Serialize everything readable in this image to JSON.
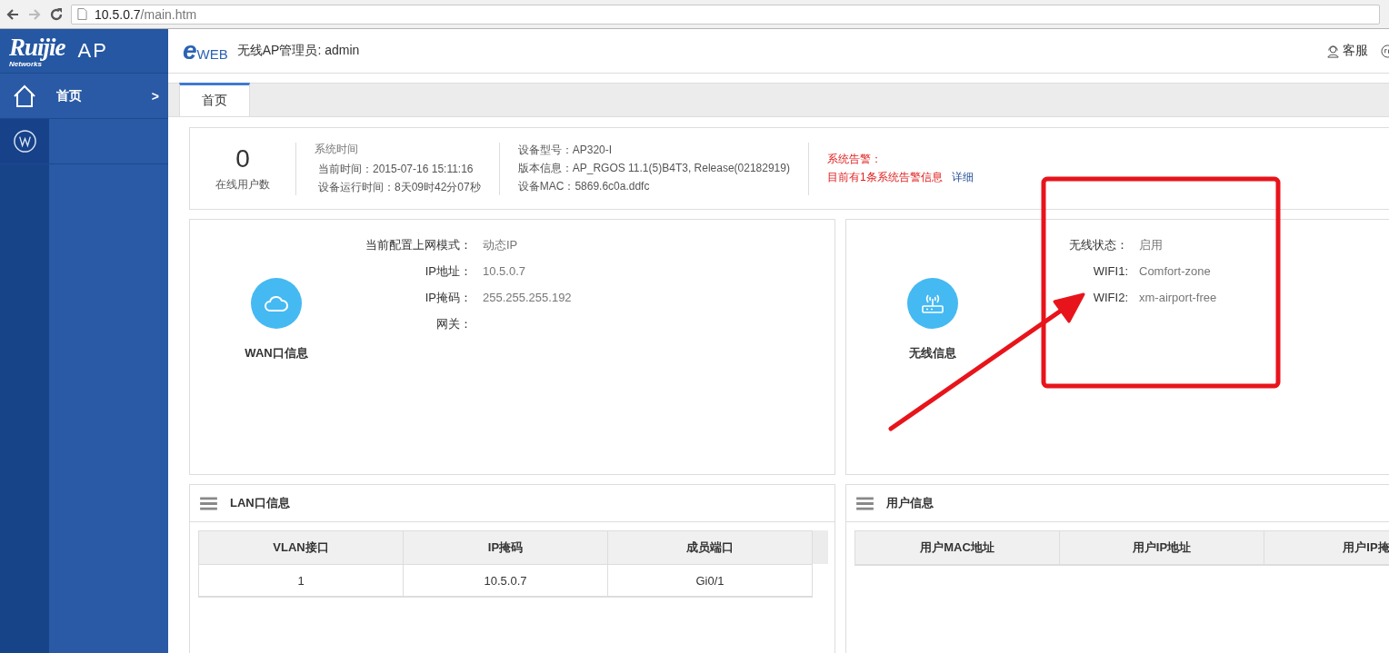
{
  "browser": {
    "url_host": "10.5.0.7",
    "url_path": "/main.htm"
  },
  "logo": {
    "brand": "Ruijie",
    "tagline": "Networks",
    "product": "AP"
  },
  "sidebar": {
    "items": [
      {
        "kind": "home",
        "label": "首页",
        "arrow": ">",
        "selected": true
      },
      {
        "kind": "wireless",
        "selected": false
      }
    ]
  },
  "header": {
    "logo_mark": "e",
    "logo_text": "WEB",
    "title": "无线AP管理员: admin",
    "links": [
      {
        "kind": "support",
        "label": "客服"
      },
      {
        "kind": "help"
      }
    ]
  },
  "tabs": [
    {
      "label": "首页",
      "selected": true
    }
  ],
  "summary": {
    "online_count": "0",
    "online_label": "在线用户数",
    "time_title": "系统时间",
    "time_rows": [
      {
        "label": "当前时间：",
        "value": "2015-07-16 15:11:16"
      },
      {
        "label": "设备运行时间：",
        "value": "8天09时42分07秒"
      }
    ],
    "device_rows": [
      {
        "label": "设备型号：",
        "value": "AP320-I"
      },
      {
        "label": "版本信息：",
        "value": "AP_RGOS 11.1(5)B4T3, Release(02182919)"
      },
      {
        "label": "设备MAC：",
        "value": "5869.6c0a.ddfc"
      }
    ],
    "alarm": {
      "title": "系统告警：",
      "message": "目前有1条系统告警信息",
      "link": "详细"
    }
  },
  "panels": [
    {
      "kind": "wan",
      "title": "WAN口信息",
      "rows": [
        {
          "label": "当前配置上网模式：",
          "value": "动态IP"
        },
        {
          "label": "IP地址：",
          "value": "10.5.0.7"
        },
        {
          "label": "IP掩码：",
          "value": "255.255.255.192"
        },
        {
          "label": "网关："
        }
      ]
    },
    {
      "kind": "wireless",
      "title": "无线信息",
      "rows": [
        {
          "label": "无线状态：",
          "value": "启用"
        },
        {
          "label": "WIFI1:",
          "value": "Comfort-zone"
        },
        {
          "label": "WIFI2:",
          "value": "xm-airport-free"
        }
      ]
    }
  ],
  "tables": [
    {
      "title": "LAN口信息",
      "columns": [
        "VLAN接口",
        "IP掩码",
        "成员端口"
      ],
      "rows": [
        [
          "1",
          "10.5.0.7",
          "Gi0/1"
        ]
      ]
    },
    {
      "title": "用户信息",
      "columns": [
        "用户MAC地址",
        "用户IP地址",
        "用户IP掩"
      ]
    }
  ],
  "annotation": {
    "highlight_box": true,
    "arrow": true
  }
}
